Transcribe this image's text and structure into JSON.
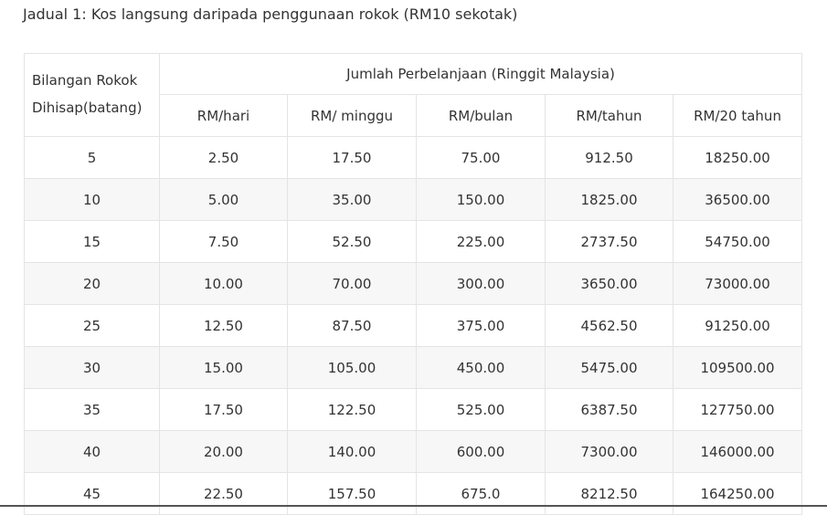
{
  "caption": "Jadual 1: Kos langsung daripada penggunaan rokok (RM10 sekotak)",
  "table": {
    "row_header_line1": "Bilangan Rokok",
    "row_header_line2": "Dihisap(batang)",
    "group_header": "Jumlah Perbelanjaan (Ringgit Malaysia)",
    "columns": [
      "RM/hari",
      "RM/ minggu",
      "RM/bulan",
      "RM/tahun",
      "RM/20 tahun"
    ],
    "rows": [
      [
        "5",
        "2.50",
        "17.50",
        "75.00",
        "912.50",
        "18250.00"
      ],
      [
        "10",
        "5.00",
        "35.00",
        "150.00",
        "1825.00",
        "36500.00"
      ],
      [
        "15",
        "7.50",
        "52.50",
        "225.00",
        "2737.50",
        "54750.00"
      ],
      [
        "20",
        "10.00",
        "70.00",
        "300.00",
        "3650.00",
        "73000.00"
      ],
      [
        "25",
        "12.50",
        "87.50",
        "375.00",
        "4562.50",
        "91250.00"
      ],
      [
        "30",
        "15.00",
        "105.00",
        "450.00",
        "5475.00",
        "109500.00"
      ],
      [
        "35",
        "17.50",
        "122.50",
        "525.00",
        "6387.50",
        "127750.00"
      ],
      [
        "40",
        "20.00",
        "140.00",
        "600.00",
        "7300.00",
        "146000.00"
      ],
      [
        "45",
        "22.50",
        "157.50",
        "675.0",
        "8212.50",
        "164250.00"
      ]
    ]
  }
}
